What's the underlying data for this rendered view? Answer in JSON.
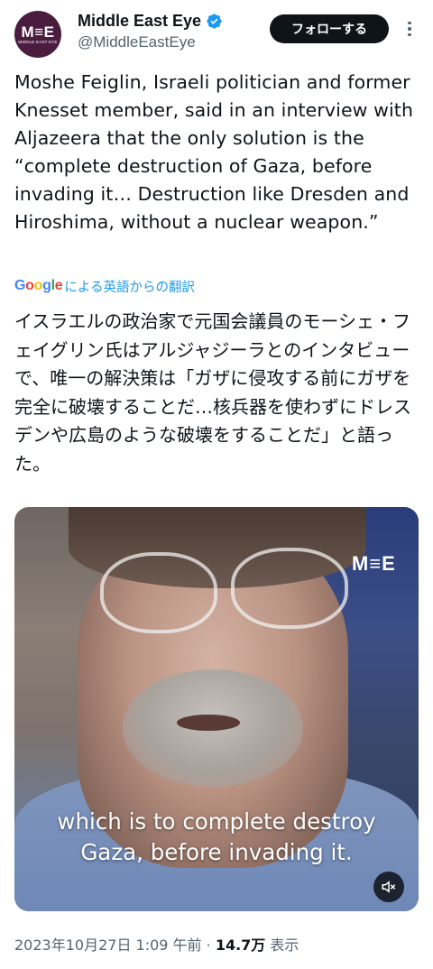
{
  "header": {
    "avatar_logo": "M≡E",
    "avatar_subtext": "MIDDLE EAST EYE",
    "display_name": "Middle East Eye",
    "handle": "@MiddleEastEye",
    "follow_label": "フォローする",
    "verified_color": "#1d9bf0"
  },
  "tweet": {
    "text": "Moshe Feiglin, Israeli politician and former Knesset member, said in an interview with Aljazeera that the only solution is the “complete destruction of Gaza, before invading it… Destruction like Dresden and Hiroshima, without a nuclear weapon.”",
    "translate_brand": "Google",
    "translate_label": "による英語からの翻訳",
    "translation": "イスラエルの政治家で元国会議員のモーシェ・フェイグリン氏はアルジャジーラとのインタビューで、唯一の解決策は「ガザに侵攻する前にガザを完全に破壊することだ…核兵器を使わずにドレスデンや広島のような破壊をすることだ」と語った。"
  },
  "media": {
    "watermark": "M≡E",
    "caption_line1": "which is to complete destroy",
    "caption_line2": "Gaza, before invading it.",
    "mute_icon": "speaker-muted-icon"
  },
  "meta": {
    "timestamp": "2023年10月27日 1:09 午前",
    "separator": " · ",
    "views_count": "14.7万",
    "views_label": " 表示"
  },
  "colors": {
    "link_blue": "#1d9bf0",
    "text_primary": "#0f1419",
    "text_secondary": "#536471",
    "avatar_bg": "#4a1d3f"
  }
}
